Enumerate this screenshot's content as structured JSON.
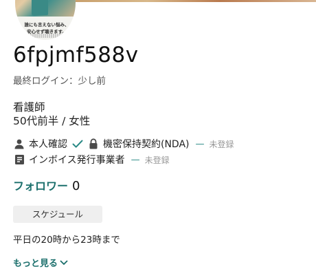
{
  "profile": {
    "avatar": {
      "line1": "誰にも言えない悩み、",
      "line2": "安心せず聴きます。"
    },
    "username": "6fpjmf588v",
    "last_login": "最終ログイン：少し前",
    "occupation": "看護師",
    "demographics": "50代前半 / 女性"
  },
  "verification": {
    "identity_label": "本人確認",
    "identity_verified": true,
    "nda_label": "機密保持契約(NDA)",
    "nda_status": "未登録",
    "invoice_label": "インボイス発行事業者",
    "invoice_status": "未登録",
    "dash": "—"
  },
  "followers": {
    "label": "フォロワー",
    "count": "0"
  },
  "schedule": {
    "chip_label": "スケジュール",
    "text": "平日の20時から23時まで"
  },
  "more": {
    "label": "もっと見る"
  },
  "colors": {
    "accent": "#1b6f6c",
    "check": "#2a8a86",
    "muted": "#999999"
  }
}
